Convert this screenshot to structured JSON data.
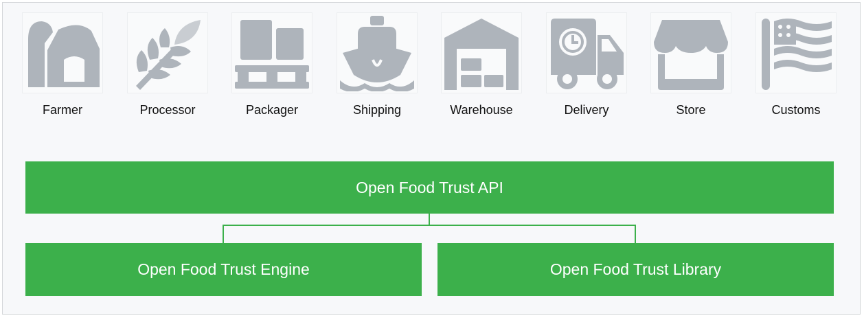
{
  "colors": {
    "icon_gray": "#aeb4bb",
    "green": "#3cb04b",
    "line_green": "#3cb04b"
  },
  "actors": [
    {
      "label": "Farmer",
      "icon": "barn-icon"
    },
    {
      "label": "Processor",
      "icon": "wheat-icon"
    },
    {
      "label": "Packager",
      "icon": "pallet-boxes-icon"
    },
    {
      "label": "Shipping",
      "icon": "ship-icon"
    },
    {
      "label": "Warehouse",
      "icon": "warehouse-icon"
    },
    {
      "label": "Delivery",
      "icon": "delivery-truck-icon"
    },
    {
      "label": "Store",
      "icon": "storefront-icon"
    },
    {
      "label": "Customs",
      "icon": "flag-icon"
    }
  ],
  "api": {
    "label": "Open Food Trust API"
  },
  "engine": {
    "label": "Open Food Trust Engine"
  },
  "library": {
    "label": "Open Food Trust Library"
  }
}
